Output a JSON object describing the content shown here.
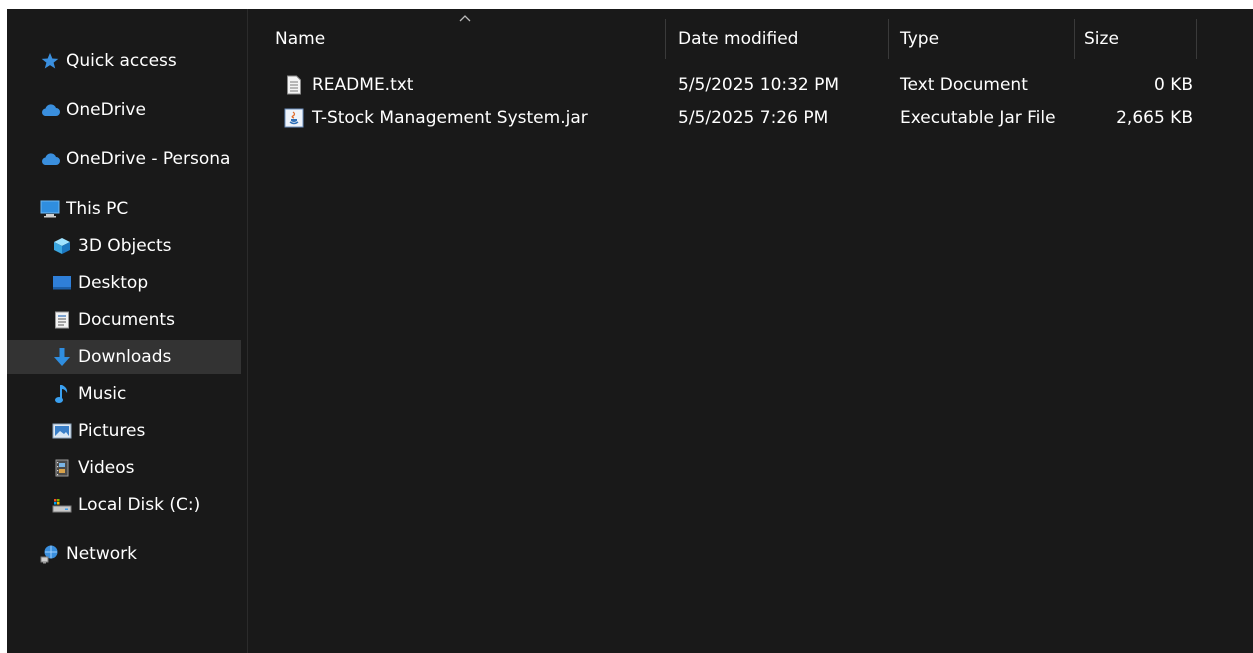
{
  "nav": {
    "quick_access": "Quick access",
    "onedrive": "OneDrive",
    "onedrive_personal": "OneDrive - Persona",
    "this_pc": "This PC",
    "objects_3d": "3D Objects",
    "desktop": "Desktop",
    "documents": "Documents",
    "downloads": "Downloads",
    "music": "Music",
    "pictures": "Pictures",
    "videos": "Videos",
    "local_disk": "Local Disk (C:)",
    "network": "Network"
  },
  "columns": {
    "name": "Name",
    "date_modified": "Date modified",
    "type": "Type",
    "size": "Size"
  },
  "files": [
    {
      "name": "README.txt",
      "date": "5/5/2025 10:32 PM",
      "type": "Text Document",
      "size": "0 KB",
      "icon": "text-file-icon"
    },
    {
      "name": "T-Stock Management System.jar",
      "date": "5/5/2025 7:26 PM",
      "type": "Executable Jar File",
      "size": "2,665 KB",
      "icon": "jar-file-icon"
    }
  ],
  "colors": {
    "background": "#191919",
    "selected": "#333333",
    "accent_blue": "#2f8ee0"
  }
}
